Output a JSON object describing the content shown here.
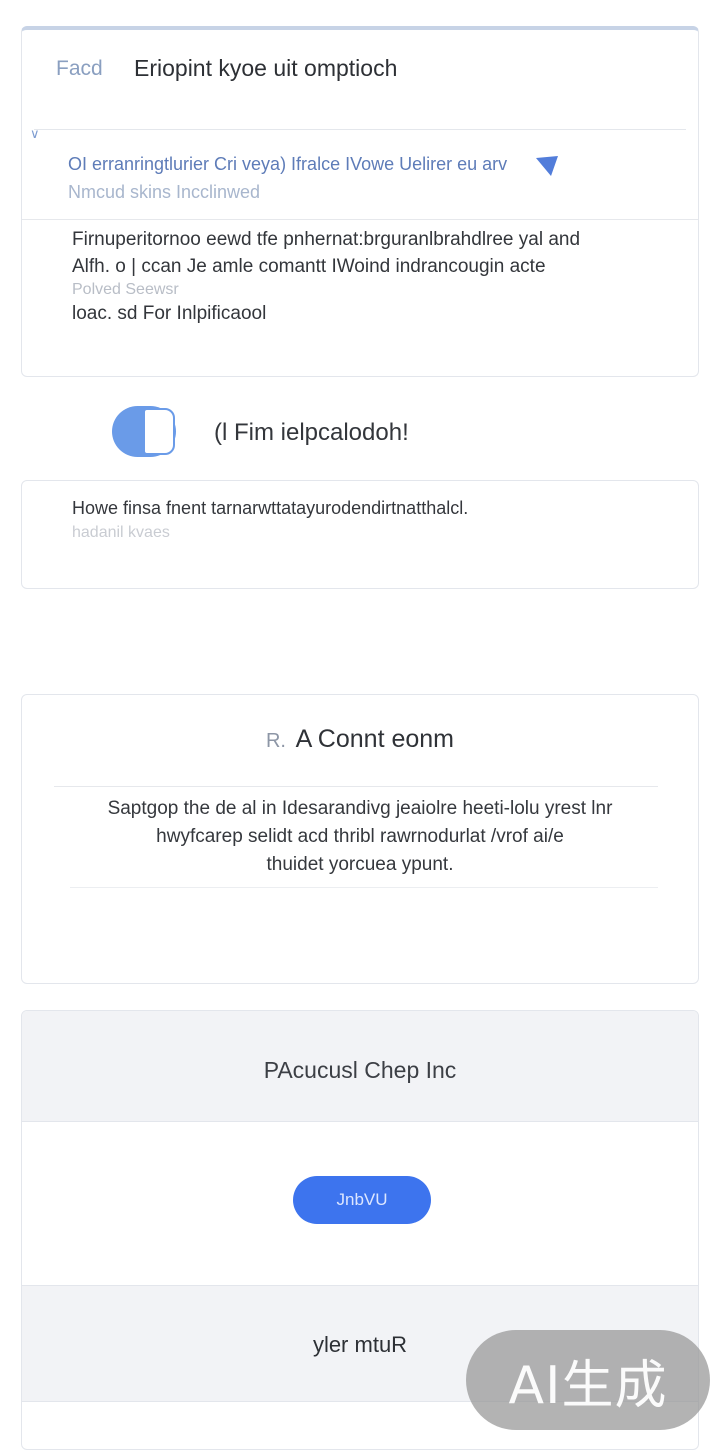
{
  "card1": {
    "badge": "Facd",
    "title": "Eriopint kyoe uit omptioch",
    "subtitle_line1": "OI erranringtlurier Cri veya) Ifralce IVowe Uelirer eu arv",
    "subtitle_line2": "Nmcud skins Incclinwed",
    "body_line1": "Firnuperitornoo eewd tfe pnhernat:brguranlbrahdlree yal and",
    "body_line2": "Alfh. o | ccan Je amle comantt IWoind indrancougin acte",
    "body_dim": "Polved Seewsr",
    "body_line3": "loac. sd For Inlpificaool"
  },
  "toggle": {
    "label": "(l Fim ielpcalodoh!",
    "on": true
  },
  "card2": {
    "text": "Howe finsa fnent tarnarwttatayurodendirtnatthalcl.",
    "sub": "hadanil kvaes"
  },
  "card3": {
    "prefix": "R.",
    "heading": "A Connt eonm",
    "body_line1": "Saptgop the de al in Idesarandivg jeaiolre heeti-lolu yrest lnr",
    "body_line2": "hwyfcarep selidt acd thribl rawrnodurlat /vrof ai/e",
    "body_line3": "thuidet yorcuea ypunt."
  },
  "card4": {
    "band1_label": "PAcucusl  Chep Inc",
    "button_label": "JnbVU",
    "band2_label": "yler mtuR"
  },
  "watermark": "AI生成",
  "colors": {
    "accent": "#3d74ee",
    "toggle": "#6a9be8",
    "subtitle": "#5e7cb8"
  }
}
